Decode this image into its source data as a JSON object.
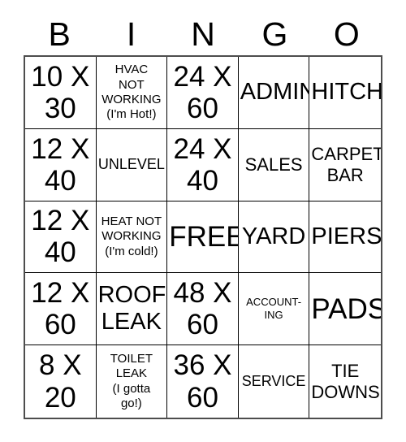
{
  "header": {
    "letters": [
      "B",
      "I",
      "N",
      "G",
      "O"
    ]
  },
  "grid": {
    "rows": 5,
    "columns": 5,
    "border_color": "#000000",
    "background_color": "#ffffff",
    "text_color": "#000000",
    "cells": [
      {
        "text": "10 X\n30",
        "size": "fs-xl"
      },
      {
        "text": "HVAC\nNOT\nWORKING\n(I'm Hot!)",
        "size": "fs-xs"
      },
      {
        "text": "24 X\n60",
        "size": "fs-xl"
      },
      {
        "text": "ADMIN",
        "size": "fs-lg"
      },
      {
        "text": "HITCH",
        "size": "fs-lg"
      },
      {
        "text": "12 X\n40",
        "size": "fs-xl"
      },
      {
        "text": "UNLEVEL",
        "size": "fs-sm"
      },
      {
        "text": "24 X\n40",
        "size": "fs-xl"
      },
      {
        "text": "SALES",
        "size": "fs-md"
      },
      {
        "text": "CARPET\nBAR",
        "size": "fs-md"
      },
      {
        "text": "12 X\n40",
        "size": "fs-xl"
      },
      {
        "text": "HEAT NOT\nWORKING\n(I'm cold!)",
        "size": "fs-xs"
      },
      {
        "text": "FREE!",
        "size": "fs-xl"
      },
      {
        "text": "YARD",
        "size": "fs-lg"
      },
      {
        "text": "PIERS",
        "size": "fs-lg"
      },
      {
        "text": "12 X\n60",
        "size": "fs-xl"
      },
      {
        "text": "ROOF\nLEAK",
        "size": "fs-lg"
      },
      {
        "text": "48 X\n60",
        "size": "fs-xl"
      },
      {
        "text": "ACCOUNT-\nING",
        "size": "fs-xxs"
      },
      {
        "text": "PADS",
        "size": "fs-xl"
      },
      {
        "text": "8 X\n20",
        "size": "fs-xl"
      },
      {
        "text": "TOILET\nLEAK\n(I gotta\ngo!)",
        "size": "fs-xs"
      },
      {
        "text": "36 X\n60",
        "size": "fs-xl"
      },
      {
        "text": "SERVICE",
        "size": "fs-sm"
      },
      {
        "text": "TIE\nDOWNS",
        "size": "fs-md"
      }
    ]
  }
}
